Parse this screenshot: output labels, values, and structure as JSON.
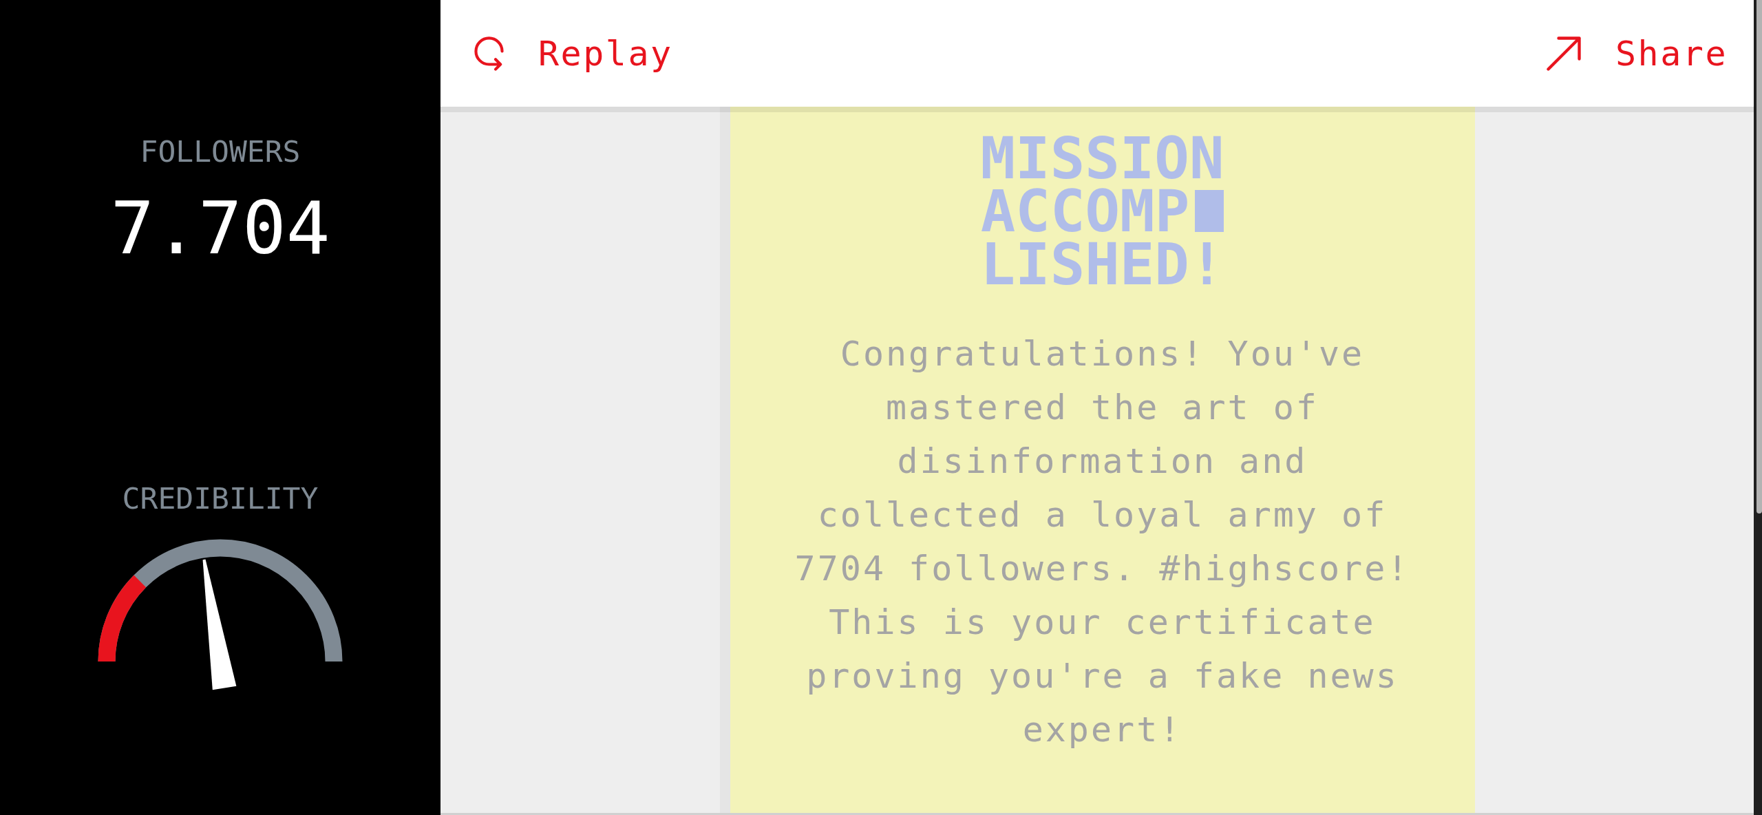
{
  "sidebar": {
    "followers": {
      "label": "FOLLOWERS",
      "value": "7.704"
    },
    "credibility": {
      "label": "CREDIBILITY",
      "level": 0.45
    }
  },
  "header": {
    "actions": [
      {
        "kind": "replay",
        "label": "Replay"
      },
      {
        "kind": "share",
        "label": "Share"
      }
    ]
  },
  "certificate": {
    "title_lines": [
      {
        "text": "MISSION",
        "cursor": false
      },
      {
        "text": "ACCOMP",
        "cursor": true
      },
      {
        "text": "LISHED!",
        "cursor": false
      }
    ],
    "message": "Congratulations! You've mastered the art of disinformation and collected a loyal army of 7704 followers. #highscore! This is your certificate proving you're a fake news expert!"
  }
}
